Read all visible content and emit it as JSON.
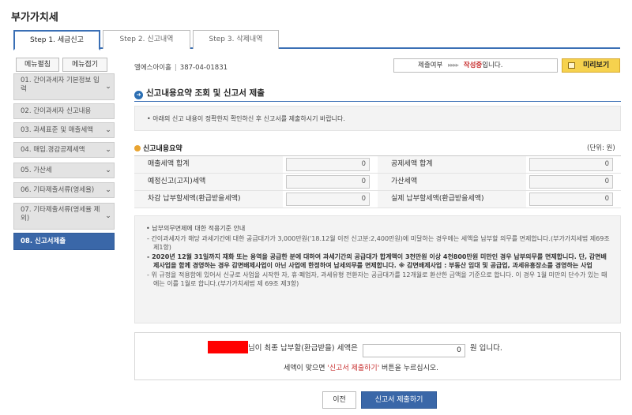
{
  "page": {
    "title": "부가가치세"
  },
  "tabs": [
    {
      "label": "Step 1. 세금신고"
    },
    {
      "label": "Step 2. 신고내역"
    },
    {
      "label": "Step 3. 삭제내역"
    }
  ],
  "sidebar": {
    "buttons": {
      "expand": "메뉴펼침",
      "collapse": "메뉴접기"
    },
    "items": [
      {
        "label": "01. 간이과세자 기본정보 입력"
      },
      {
        "label": "02. 간이과세자 신고내용"
      },
      {
        "label": "03. 과세표준 및 매출세액"
      },
      {
        "label": "04. 매입.경감공제세액"
      },
      {
        "label": "05. 가산세"
      },
      {
        "label": "06. 기타제출서류(영세율)"
      },
      {
        "label": "07. 기타제출서류(영세율 제외)"
      },
      {
        "label": "08. 신고서제출"
      }
    ]
  },
  "header": {
    "business_name": "엘에스아이홀",
    "business_number": "387-04-01831",
    "status_label": "제출여부",
    "status_arrows": "▸▸▸▸",
    "status_value": "작성중",
    "status_suffix": "입니다.",
    "preview_label": "미리보기"
  },
  "section": {
    "title": "신고내용요약 조회 및 신고서 제출",
    "notice": "아래의 신고 내용이 정확한지 확인하신 후 신고서를 제출하시기 바랍니다."
  },
  "summary": {
    "title": "신고내용요약",
    "unit": "(단위: 원)",
    "rows": [
      {
        "left_label": "매출세액 합계",
        "left_value": "0",
        "right_label": "공제세액 합계",
        "right_value": "0"
      },
      {
        "left_label": "예정신고(고지)세액",
        "left_value": "0",
        "right_label": "가산세액",
        "right_value": "0"
      },
      {
        "left_label": "차감 납부할세액(환급받을세액)",
        "left_value": "0",
        "right_label": "실제 납부할세액(환급받을세액)",
        "right_value": "0"
      }
    ]
  },
  "guide": {
    "heading": "납부의무면제에 대한 적용기준 안내",
    "items": [
      "간이과세자가 해당 과세기간에 대한 공급대가가 3,000만원('18.12월 이전 신고분:2,400만원)에 미달하는 경우에는 세액을 납부할 의무를 면제합니다.(부가가치세법 제69조 제1항)",
      "2020년 12월 31일까지 재화 또는 용역을 공급한 분에 대하여 과세기간의 공급대가 합계액이 3천만원 이상 4천800만원 미만인 경우 납부의무를 면제합니다. 단, 감면배제사업을 함께 경영하는 경우 감면배제사업이 아닌 사업에 한정하여 납세의무를 면제합니다. ※ 감면배제사업 : 부동산 임대 및 공급업, 과세유흥장소를 경영하는 사업",
      "위 규정을 적용함에 있어서 신규로 사업을 시작한 자, 휴·폐업자, 과세유형 전환자는 공급대가를 12개월로 환산한 금액을 기준으로 합니다. 이 경우 1월 미만의 단수가 있는 때에는 이를 1월로 합니다.(부가가치세법 제 69조 제3항)"
    ]
  },
  "final": {
    "text_before": "님이 최종 납부할(환급받을) 세액은",
    "amount": "0",
    "text_after": "원 입니다.",
    "confirm_before": "세액이 맞으면 ",
    "confirm_highlight": "'신고서 제출하기'",
    "confirm_after": " 버튼을 누르십시오."
  },
  "buttons": {
    "prev": "이전",
    "submit": "신고서 제출하기"
  },
  "colors": {
    "accent": "#3a67a8",
    "highlight": "#f6d24e",
    "status_red": "#c83030"
  },
  "icons": {
    "section": "arrow-circle-icon",
    "summary": "dot-icon",
    "preview": "document-icon",
    "chevron": "chevron-down-icon"
  }
}
